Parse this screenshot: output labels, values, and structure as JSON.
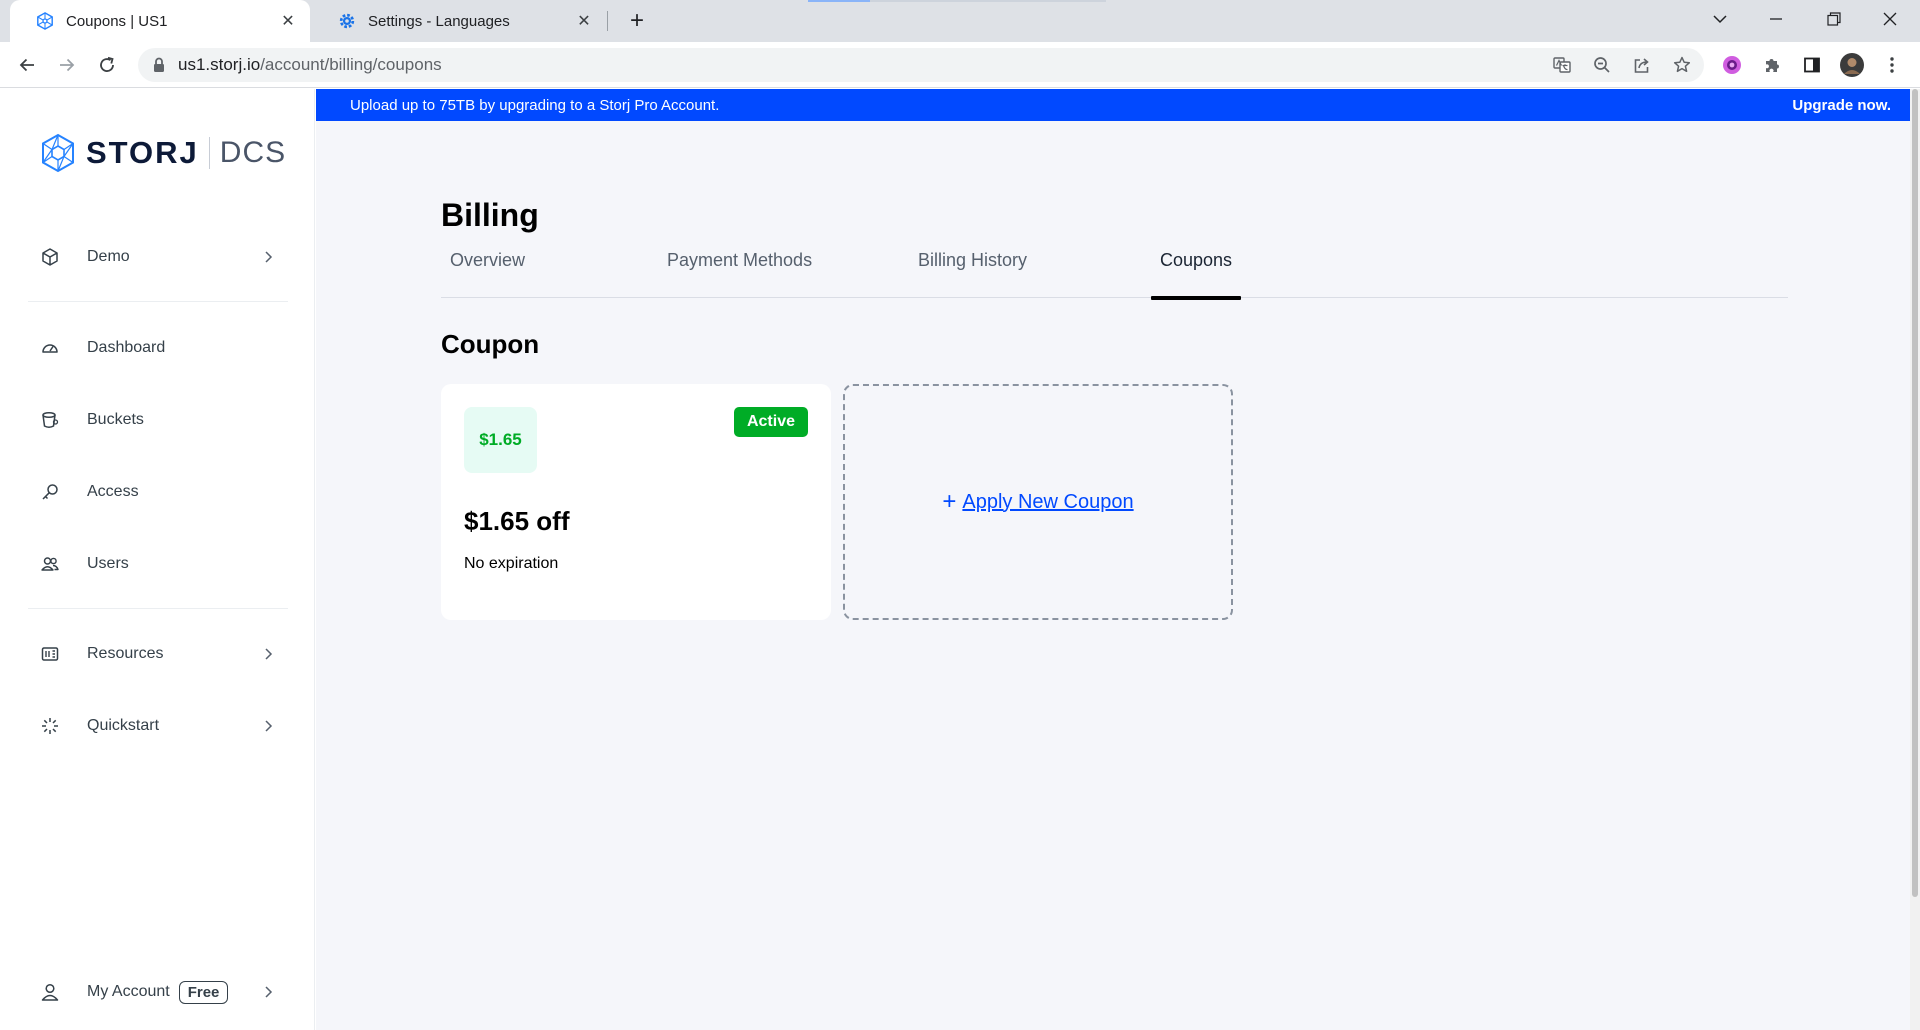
{
  "browser": {
    "tabs": [
      {
        "title": "Coupons | US1",
        "active": true
      },
      {
        "title": "Settings - Languages",
        "active": false
      }
    ],
    "close_glyph": "✕",
    "new_tab_glyph": "+",
    "url_host": "us1.storj.io",
    "url_path": "/account/billing/coupons"
  },
  "sidebar": {
    "brand": "STORJ",
    "product": "DCS",
    "project": "Demo",
    "items": [
      {
        "label": "Dashboard",
        "icon": "dashboard-icon"
      },
      {
        "label": "Buckets",
        "icon": "bucket-icon"
      },
      {
        "label": "Access",
        "icon": "key-icon"
      },
      {
        "label": "Users",
        "icon": "users-icon"
      }
    ],
    "resources": "Resources",
    "quickstart": "Quickstart",
    "account": "My Account",
    "plan": "Free"
  },
  "banner": {
    "message": "Upload up to 75TB by upgrading to a Storj Pro Account.",
    "cta": "Upgrade now."
  },
  "billing": {
    "title": "Billing",
    "tabs": [
      "Overview",
      "Payment Methods",
      "Billing History",
      "Coupons"
    ],
    "active_tab": "Coupons",
    "section_title": "Coupon"
  },
  "coupon": {
    "chip": "$1.65",
    "status": "Active",
    "amount": "$1.65 off",
    "expiry": "No expiration"
  },
  "apply": {
    "plus": "+",
    "label": "Apply New Coupon"
  },
  "colors": {
    "accent": "#0149ff",
    "success": "#00ac26",
    "chip_bg": "#e6fbf4",
    "page_bg": "#f5f6fa"
  }
}
